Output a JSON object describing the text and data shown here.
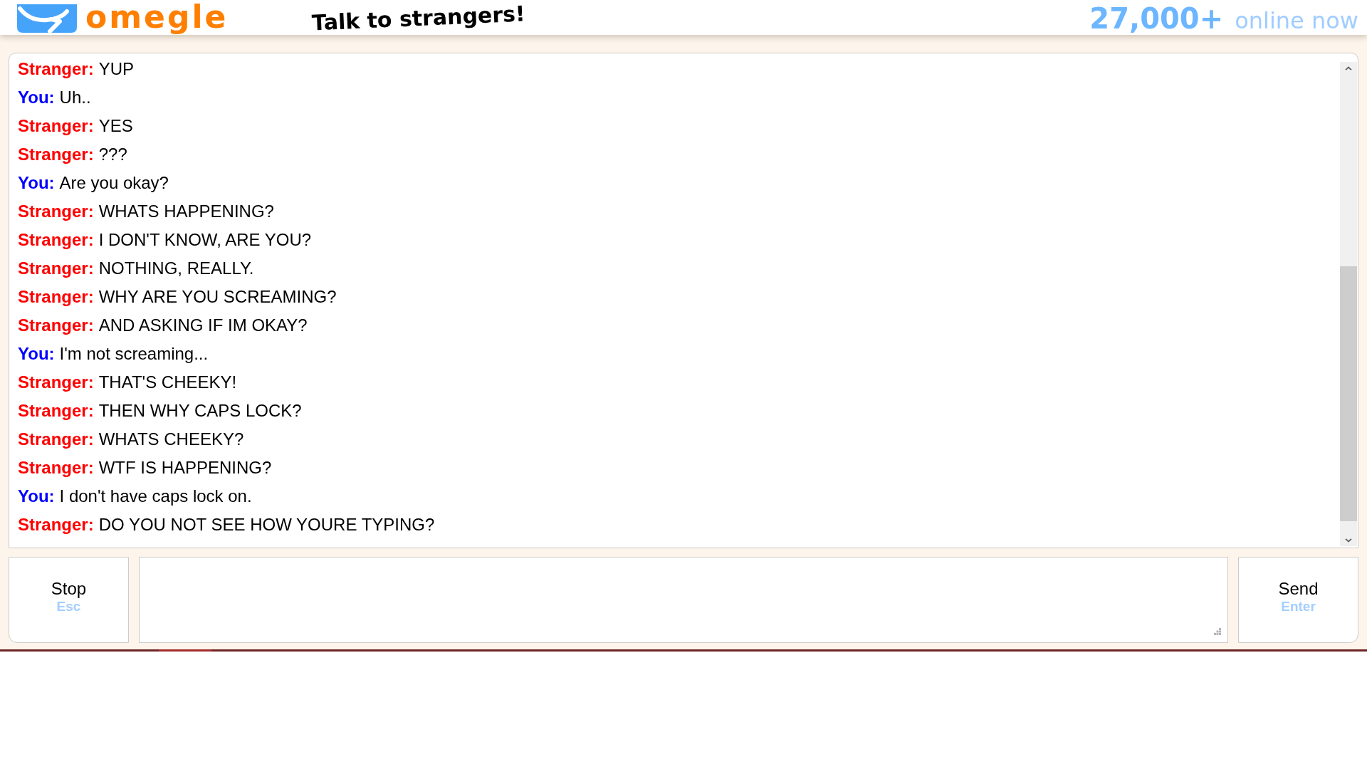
{
  "header": {
    "logo_text": "omegle",
    "tagline": "Talk to strangers!",
    "online_count": "27,000+",
    "online_label": "online now"
  },
  "chat_log": {
    "messages": [
      {
        "kind": "stranger",
        "sender": "Stranger:",
        "text": "YUP"
      },
      {
        "kind": "you",
        "sender": "You:",
        "text": "Uh.."
      },
      {
        "kind": "stranger",
        "sender": "Stranger:",
        "text": "YES"
      },
      {
        "kind": "stranger",
        "sender": "Stranger:",
        "text": "???"
      },
      {
        "kind": "you",
        "sender": "You:",
        "text": "Are you okay?"
      },
      {
        "kind": "stranger",
        "sender": "Stranger:",
        "text": "WHATS HAPPENING?"
      },
      {
        "kind": "stranger",
        "sender": "Stranger:",
        "text": "I DON'T KNOW, ARE YOU?"
      },
      {
        "kind": "stranger",
        "sender": "Stranger:",
        "text": "NOTHING, REALLY."
      },
      {
        "kind": "stranger",
        "sender": "Stranger:",
        "text": "WHY ARE YOU SCREAMING?"
      },
      {
        "kind": "stranger",
        "sender": "Stranger:",
        "text": "AND ASKING IF IM OKAY?"
      },
      {
        "kind": "you",
        "sender": "You:",
        "text": "I'm not screaming..."
      },
      {
        "kind": "stranger",
        "sender": "Stranger:",
        "text": "THAT'S CHEEKY!"
      },
      {
        "kind": "stranger",
        "sender": "Stranger:",
        "text": "THEN WHY CAPS LOCK?"
      },
      {
        "kind": "stranger",
        "sender": "Stranger:",
        "text": "WHATS CHEEKY?"
      },
      {
        "kind": "stranger",
        "sender": "Stranger:",
        "text": "WTF IS HAPPENING?"
      },
      {
        "kind": "you",
        "sender": "You:",
        "text": "I don't have caps lock on."
      },
      {
        "kind": "stranger",
        "sender": "Stranger:",
        "text": "DO YOU NOT SEE HOW YOURE TYPING?"
      }
    ]
  },
  "controls": {
    "stop_button": {
      "label": "Stop",
      "shortcut": "Esc"
    },
    "send_button": {
      "label": "Send",
      "shortcut": "Enter"
    }
  }
}
